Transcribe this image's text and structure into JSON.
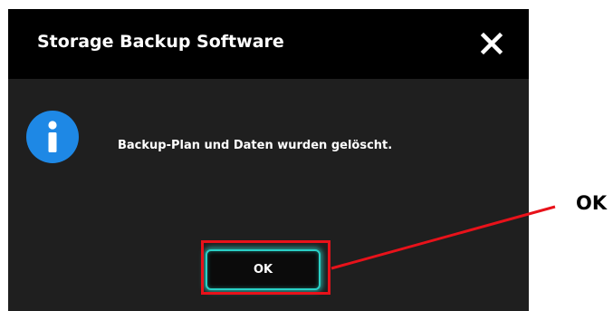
{
  "dialog": {
    "title": "Storage Backup Software",
    "close_icon": "close-icon",
    "info_icon": "info-icon",
    "message": "Backup-Plan und Daten wurden gelöscht.",
    "ok_label": "OK"
  },
  "annotation": {
    "label": "OK",
    "highlight_color": "#e8121a"
  },
  "colors": {
    "titlebar": "#000000",
    "dialog_body": "#1f1f1f",
    "info_icon": "#1e88e5",
    "button_glow": "#2ad0c6"
  }
}
